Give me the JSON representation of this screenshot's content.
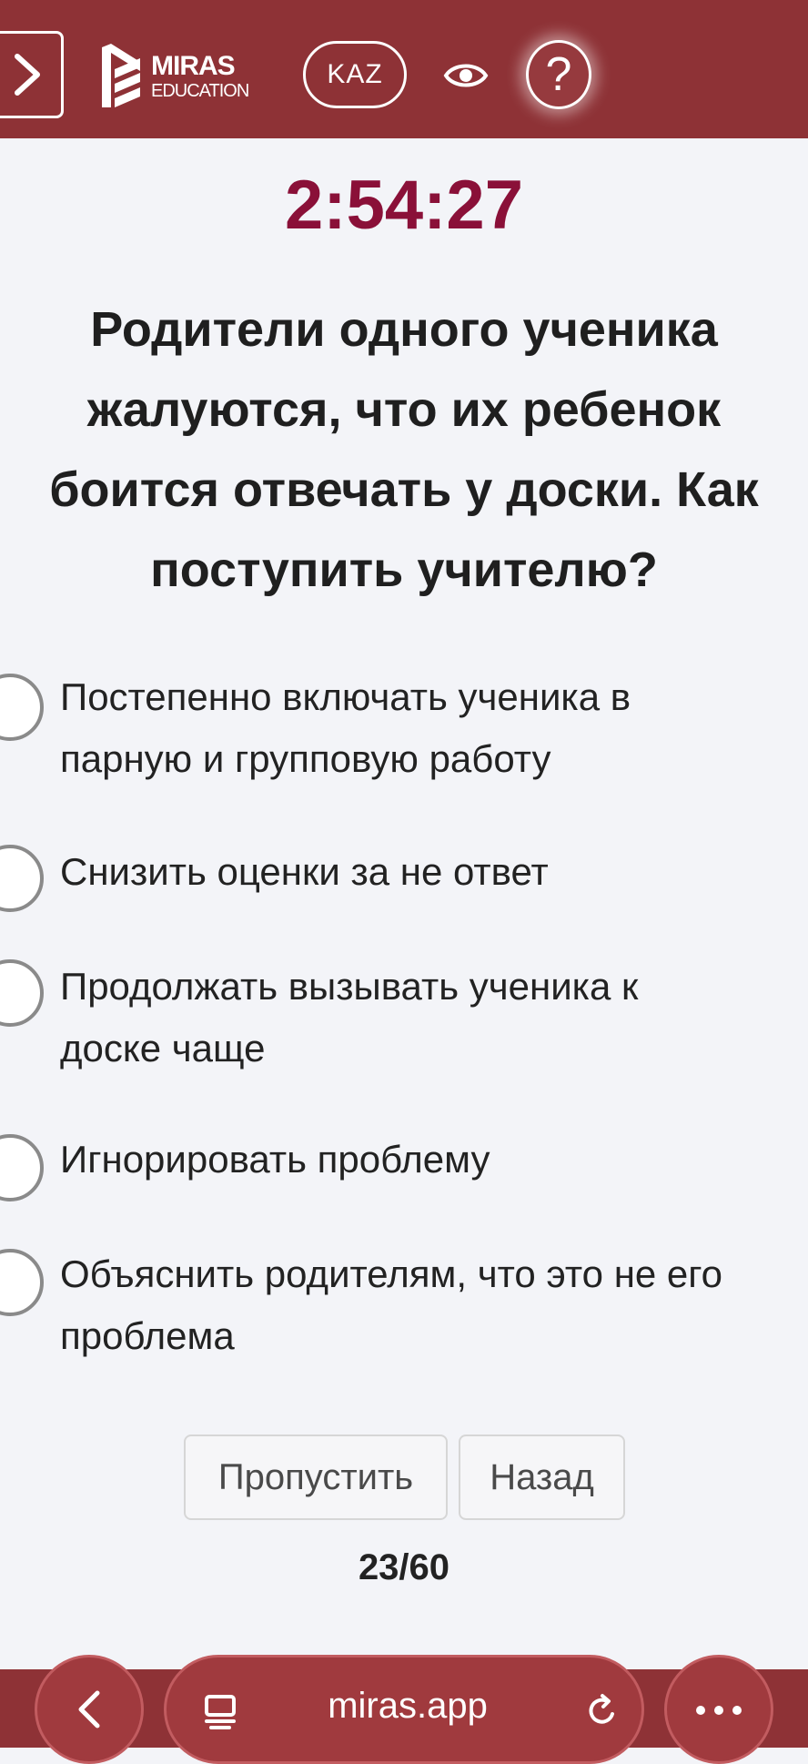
{
  "header": {
    "logo": {
      "brand": "MIRAS",
      "sub": "EDUCATION"
    },
    "language_button": "KAZ",
    "help_symbol": "?",
    "colors": {
      "bar": "#8e3236",
      "foreground": "#ffffff"
    },
    "icons": [
      "chevron-right-icon",
      "miras-logo-icon",
      "eye-icon",
      "question-icon"
    ]
  },
  "quiz": {
    "timer": "2:54:27",
    "question_lines": [
      "Родители одного ученика",
      "жалуются, что их ребенок",
      "боится отвечать у доски. Как",
      "поступить учителю?"
    ],
    "answers": [
      {
        "lines": [
          "Постепенно включать ученика в",
          "парную и групповую работу"
        ],
        "selected": false
      },
      {
        "lines": [
          "Снизить оценки за не ответ"
        ],
        "selected": false
      },
      {
        "lines": [
          "Продолжать вызывать ученика к",
          "доске чаще"
        ],
        "selected": false
      },
      {
        "lines": [
          "Игнорировать проблему"
        ],
        "selected": false
      },
      {
        "lines": [
          "Объяснить родителям, что это не его",
          "проблема"
        ],
        "selected": false
      }
    ],
    "buttons": {
      "skip": "Пропустить",
      "back": "Назад"
    },
    "progress": "23/60",
    "colors": {
      "timer": "#8a1038",
      "text": "#1f1f1f",
      "background": "#f3f4f8"
    }
  },
  "browser": {
    "url": "miras.app",
    "icons": [
      "back-arrow-icon",
      "reader-icon",
      "reload-icon",
      "more-icon"
    ]
  }
}
